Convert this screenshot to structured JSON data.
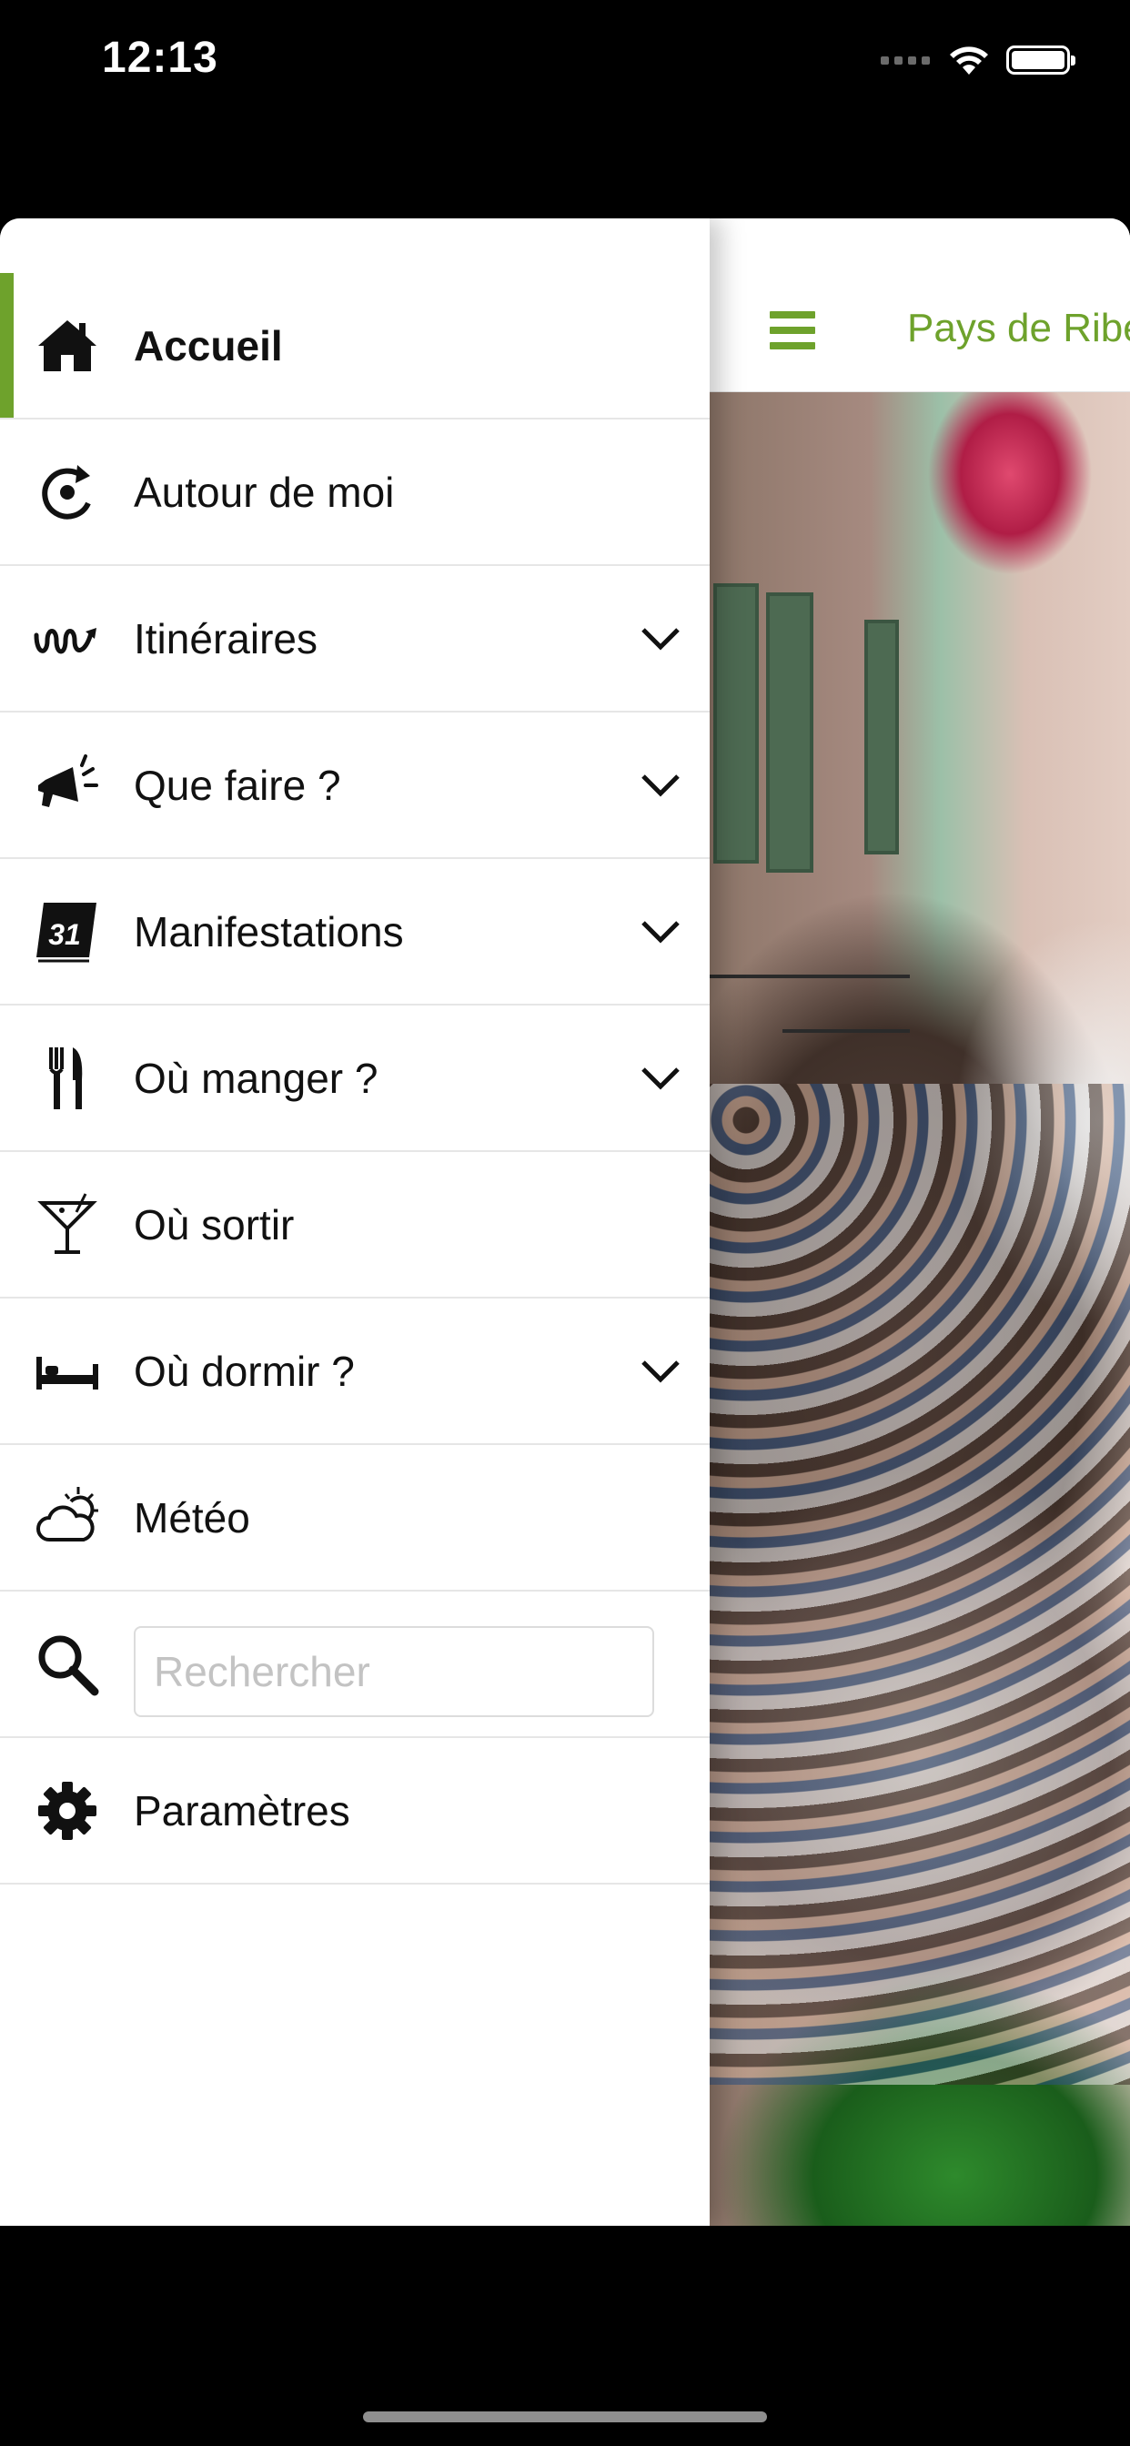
{
  "status_bar": {
    "time": "12:13"
  },
  "header": {
    "title": "Pays de Ribeauvillé",
    "menu_icon": "hamburger-icon"
  },
  "colors": {
    "accent": "#6ea22c",
    "divider": "#e6e6e6"
  },
  "menu": {
    "items": [
      {
        "label": "Accueil",
        "icon": "home-icon",
        "expandable": false,
        "active": true
      },
      {
        "label": "Autour de moi",
        "icon": "location-refresh-icon",
        "expandable": false,
        "active": false
      },
      {
        "label": "Itinéraires",
        "icon": "route-icon",
        "expandable": true,
        "active": false
      },
      {
        "label": "Que faire ?",
        "icon": "megaphone-icon",
        "expandable": true,
        "active": false
      },
      {
        "label": "Manifestations",
        "icon": "calendar-icon",
        "calendar_day": "31",
        "expandable": true,
        "active": false
      },
      {
        "label": "Où manger ?",
        "icon": "fork-knife-icon",
        "expandable": true,
        "active": false
      },
      {
        "label": "Où sortir",
        "icon": "cocktail-icon",
        "expandable": false,
        "active": false
      },
      {
        "label": "Où dormir ?",
        "icon": "bed-icon",
        "expandable": true,
        "active": false
      },
      {
        "label": "Météo",
        "icon": "weather-icon",
        "expandable": false,
        "active": false
      }
    ],
    "search": {
      "placeholder": "Rechercher",
      "icon": "search-icon",
      "value": ""
    },
    "settings": {
      "label": "Paramètres",
      "icon": "gear-icon"
    }
  }
}
